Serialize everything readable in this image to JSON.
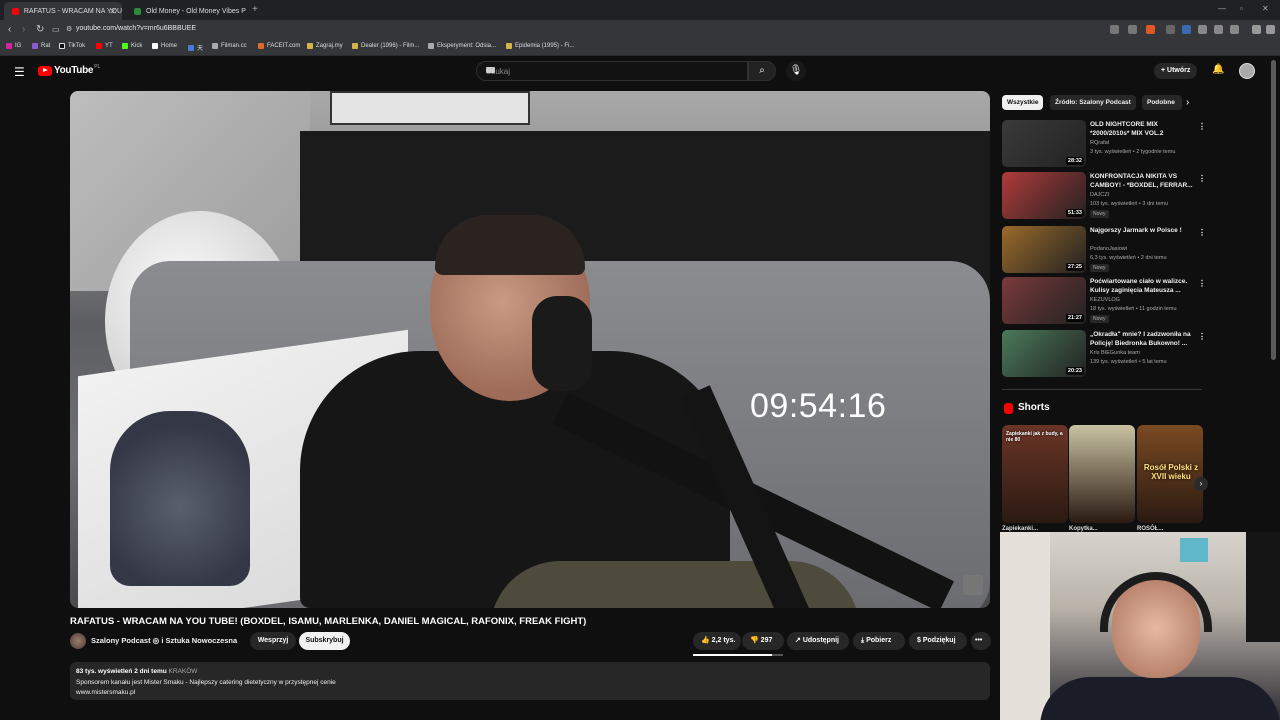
{
  "browser": {
    "tabs": [
      {
        "title": "RAFATUS - WRACAM NA YOU",
        "active": true
      },
      {
        "title": "Old Money - Old Money Vibes P",
        "active": false
      }
    ],
    "url": "youtube.com/watch?v=mr6u6BBBUEE",
    "bookmarks": [
      "IG",
      "Rat",
      "TikTok",
      "YT",
      "Kick",
      "Home",
      "天",
      "Filman.cc",
      "FACEIT.com",
      "Zagraj.my",
      "Dealer (1996) - Film...",
      "Eksperyment: Odsia...",
      "Epidemia (1995) - Fi..."
    ]
  },
  "header": {
    "logo_text": "YouTube",
    "logo_region": "PL",
    "search_placeholder": "Szukaj",
    "create_label": "Utwórz"
  },
  "video": {
    "overlay_time": "09:54:16",
    "title": "RAFATUS - WRACAM NA YOU TUBE! (BOXDEL, ISAMU, MARLENKA, DANIEL MAGICAL, RAFONIX, FREAK FIGHT)",
    "channel": "Szalony Podcast ◎ i Sztuka Nowoczesna",
    "support_label": "Wesprzyj",
    "subscribe_label": "Subskrybuj",
    "likes": "2,2 tys.",
    "like_ratio": 0.88,
    "dislikes": "297",
    "share_label": "Udostępnij",
    "download_label": "Pobierz",
    "thanks_label": "Podziękuj",
    "more_label": "•••",
    "desc_views": "83 tys. wyświetleń",
    "desc_date": "2 dni temu",
    "desc_tag": "KRAKÓW",
    "desc_line2": "Sponsorem kanału jest Mister Smaku - Najlepszy catering dietetyczny w przystępnej cenie",
    "desc_line3": "www.mistersmaku.pl"
  },
  "sidebar": {
    "chips": [
      "Wszystkie",
      "Źródło: Szalony Podcast",
      "Podobne"
    ],
    "recommendations": [
      {
        "title": "OLD NIGHTCORE MIX *2000/2010s* MIX VOL.2",
        "channel": "RQrafał",
        "meta": "3 tys. wyświetleń • 2 tygodnie temu",
        "duration": "28:32",
        "badge": "",
        "color": "#3a3a3a"
      },
      {
        "title": "KONFRONTACJA NIKITA VS CAMBOY! - *BOXDEL, FERRAR...",
        "channel": "DAJCZI",
        "meta": "103 tys. wyświetleń • 3 dni temu",
        "duration": "51:33",
        "badge": "Nowy",
        "color": "#b13a3a"
      },
      {
        "title": "Najgorszy Jarmark w Polsce !",
        "channel": "PodanoJasiowi",
        "meta": "6,3 tys. wyświetleń • 2 dni temu",
        "duration": "27:25",
        "badge": "Nowy",
        "color": "#9a6a2a"
      },
      {
        "title": "Poćwiartowane ciało w walizce. Kulisy zaginięcia Mateusza ...",
        "channel": "KEZUVLOG",
        "meta": "18 tys. wyświetleń • 11 godzin temu",
        "duration": "21:27",
        "badge": "Nowy",
        "color": "#7a3a3a"
      },
      {
        "title": "„Okradła\" mnie? I zadzwoniła na Policję! Biedronka Bukowno! ...",
        "channel": "Kris BIEGunka team",
        "meta": "139 tys. wyświetleń • 5 lat temu",
        "duration": "20:23",
        "badge": "",
        "color": "#4a7a5a"
      }
    ],
    "shorts_title": "Shorts",
    "shorts": [
      {
        "caption": "Zapiekanki jak z budy, a nie 80",
        "big": "",
        "title": "Zapiekanki...",
        "color": "#6b3526"
      },
      {
        "caption": "",
        "big": "",
        "title": "Kopytka...",
        "color": "#c9c3a3"
      },
      {
        "caption": "",
        "big": "Rosół Polski z XVII wieku",
        "title": "ROSÓŁ...",
        "color": "#7a4a22"
      }
    ]
  }
}
